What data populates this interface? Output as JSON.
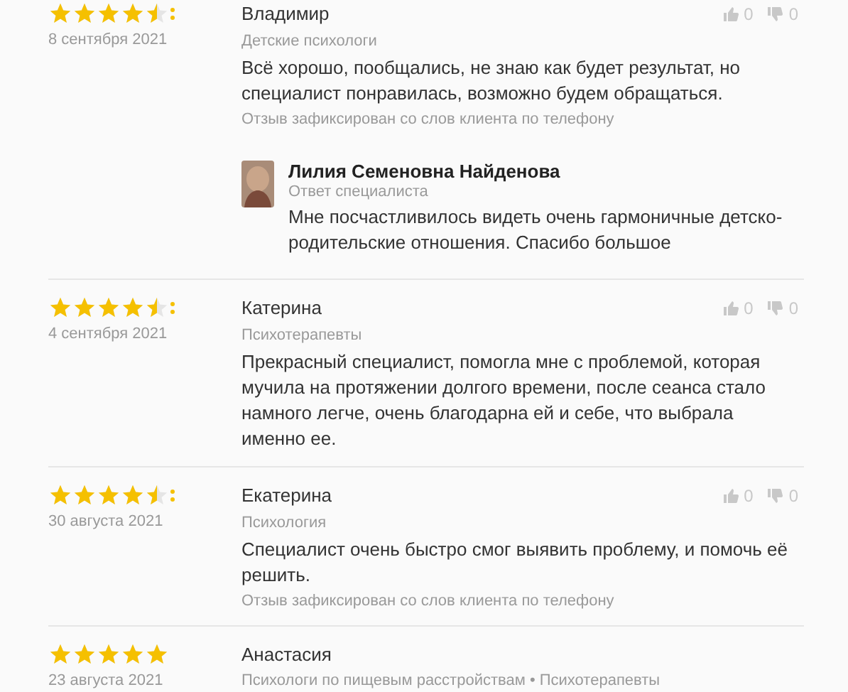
{
  "reviews": [
    {
      "stars": 4.5,
      "date": "8 сентября 2021",
      "author": "Владимир",
      "category": "Детские психологи",
      "text": "Всё хорошо, пообщались, не знаю как будет результат, но специалист понравилась, возможно будем обращаться.",
      "note": "Отзыв зафиксирован со слов клиента по телефону",
      "likes": "0",
      "dislikes": "0",
      "reply": {
        "name": "Лилия Семеновна Найденова",
        "role": "Ответ специалиста",
        "text": "Мне посчастливилось видеть очень гармоничные детско-родительские отношения. Спасибо большое"
      }
    },
    {
      "stars": 4.5,
      "date": "4 сентября 2021",
      "author": "Катерина",
      "category": "Психотерапевты",
      "text": "Прекрасный специалист, помогла мне с проблемой, которая мучила на протяжении долгого времени, после сеанса стало намного легче, очень благодарна ей и себе, что выбрала именно ее.",
      "likes": "0",
      "dislikes": "0"
    },
    {
      "stars": 4.5,
      "date": "30 августа 2021",
      "author": "Екатерина",
      "category": "Психология",
      "text": "Специалист очень быстро смог выявить проблему, и помочь её решить.",
      "note": "Отзыв зафиксирован со слов клиента по телефону",
      "likes": "0",
      "dislikes": "0"
    },
    {
      "stars": 5,
      "date": "23 августа 2021",
      "author": "Анастасия",
      "category": "Психологи по пищевым расстройствам • Психотерапевты"
    }
  ]
}
